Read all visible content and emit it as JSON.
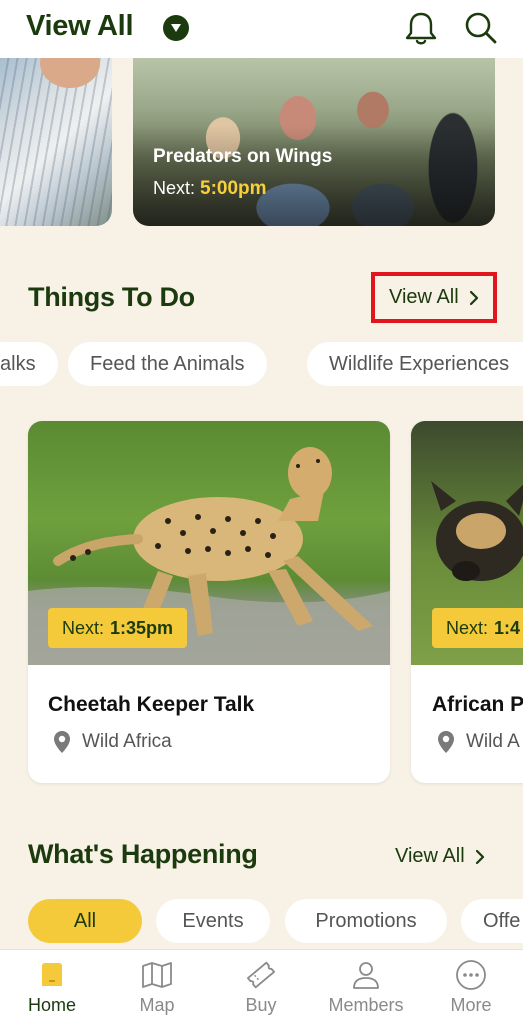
{
  "header": {
    "title": "View All"
  },
  "shows": [
    {
      "title": "",
      "next_label": "",
      "next_time": ""
    },
    {
      "title": "Predators on Wings",
      "next_label": "Next:",
      "next_time": "5:00pm"
    }
  ],
  "things_to_do": {
    "title": "Things To Do",
    "view_all": "View All",
    "chips": [
      "alks",
      "Feed the Animals",
      "Wildlife Experiences"
    ],
    "cards": [
      {
        "next_label": "Next:",
        "next_time": "1:35pm",
        "name": "Cheetah Keeper Talk",
        "location": "Wild Africa"
      },
      {
        "next_label": "Next:",
        "next_time": "1:4",
        "name": "African P",
        "location": "Wild A"
      }
    ]
  },
  "whats_happening": {
    "title": "What's Happening",
    "view_all": "View All",
    "chips": [
      "All",
      "Events",
      "Promotions",
      "Offe"
    ]
  },
  "bottom_nav": [
    {
      "label": "Home",
      "icon": "home-icon",
      "active": true
    },
    {
      "label": "Map",
      "icon": "map-icon",
      "active": false
    },
    {
      "label": "Buy",
      "icon": "ticket-icon",
      "active": false
    },
    {
      "label": "Members",
      "icon": "person-icon",
      "active": false
    },
    {
      "label": "More",
      "icon": "more-icon",
      "active": false
    }
  ],
  "colors": {
    "brand_green": "#1b3a0d",
    "accent_yellow": "#f4c93a",
    "background": "#f7f1e6",
    "highlight_red": "#e0161c"
  }
}
